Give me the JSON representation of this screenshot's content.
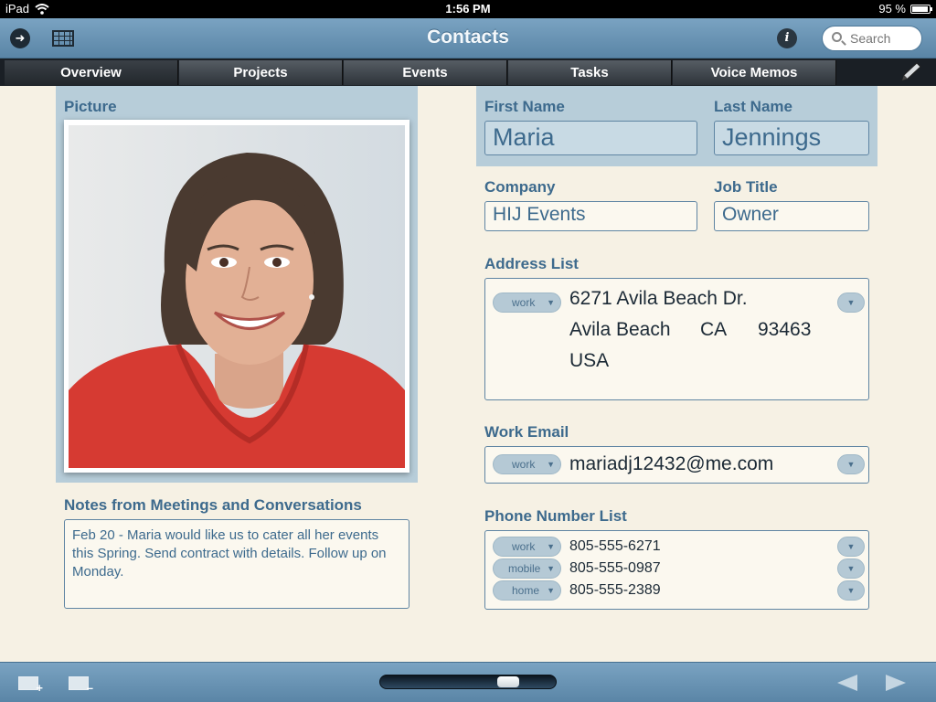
{
  "status": {
    "device": "iPad",
    "time": "1:56 PM",
    "battery": "95 %",
    "battery_level": 0.95
  },
  "titlebar": {
    "title": "Contacts",
    "info_glyph": "i",
    "search_placeholder": "Search"
  },
  "tabs": [
    {
      "label": "Overview",
      "active": true
    },
    {
      "label": "Projects"
    },
    {
      "label": "Events"
    },
    {
      "label": "Tasks"
    },
    {
      "label": "Voice Memos"
    }
  ],
  "picture": {
    "label": "Picture"
  },
  "notes": {
    "label": "Notes from Meetings and Conversations",
    "text": "Feb 20 - Maria would like us to cater all her events this Spring. Send contract with details. Follow up on Monday."
  },
  "contact": {
    "first_name_label": "First Name",
    "first_name": "Maria",
    "last_name_label": "Last Name",
    "last_name": "Jennings",
    "company_label": "Company",
    "company": "HIJ Events",
    "job_title_label": "Job Title",
    "job_title": "Owner"
  },
  "address": {
    "label": "Address List",
    "type": "work",
    "street": "6271 Avila Beach Dr.",
    "city": "Avila Beach",
    "state": "CA",
    "zip": "93463",
    "country": "USA"
  },
  "email": {
    "label": "Work Email",
    "type": "work",
    "value": "mariadj12432@me.com"
  },
  "phones": {
    "label": "Phone Number List",
    "items": [
      {
        "type": "work",
        "number": "805-555-6271"
      },
      {
        "type": "mobile",
        "number": "805-555-0987"
      },
      {
        "type": "home",
        "number": "805-555-2389"
      }
    ]
  },
  "bottombar": {
    "slider_position": 0.77
  },
  "colors": {
    "accent": "#5a85a6",
    "label": "#3d6a8d",
    "background": "#f6f1e4",
    "panel": "#b7cdd9"
  },
  "icons": [
    "wifi-icon",
    "battery-icon",
    "forward-icon",
    "grid-icon",
    "info-icon",
    "search-icon",
    "pencil-icon",
    "add-record-icon",
    "remove-record-icon",
    "previous-arrow-icon",
    "next-arrow-icon"
  ]
}
